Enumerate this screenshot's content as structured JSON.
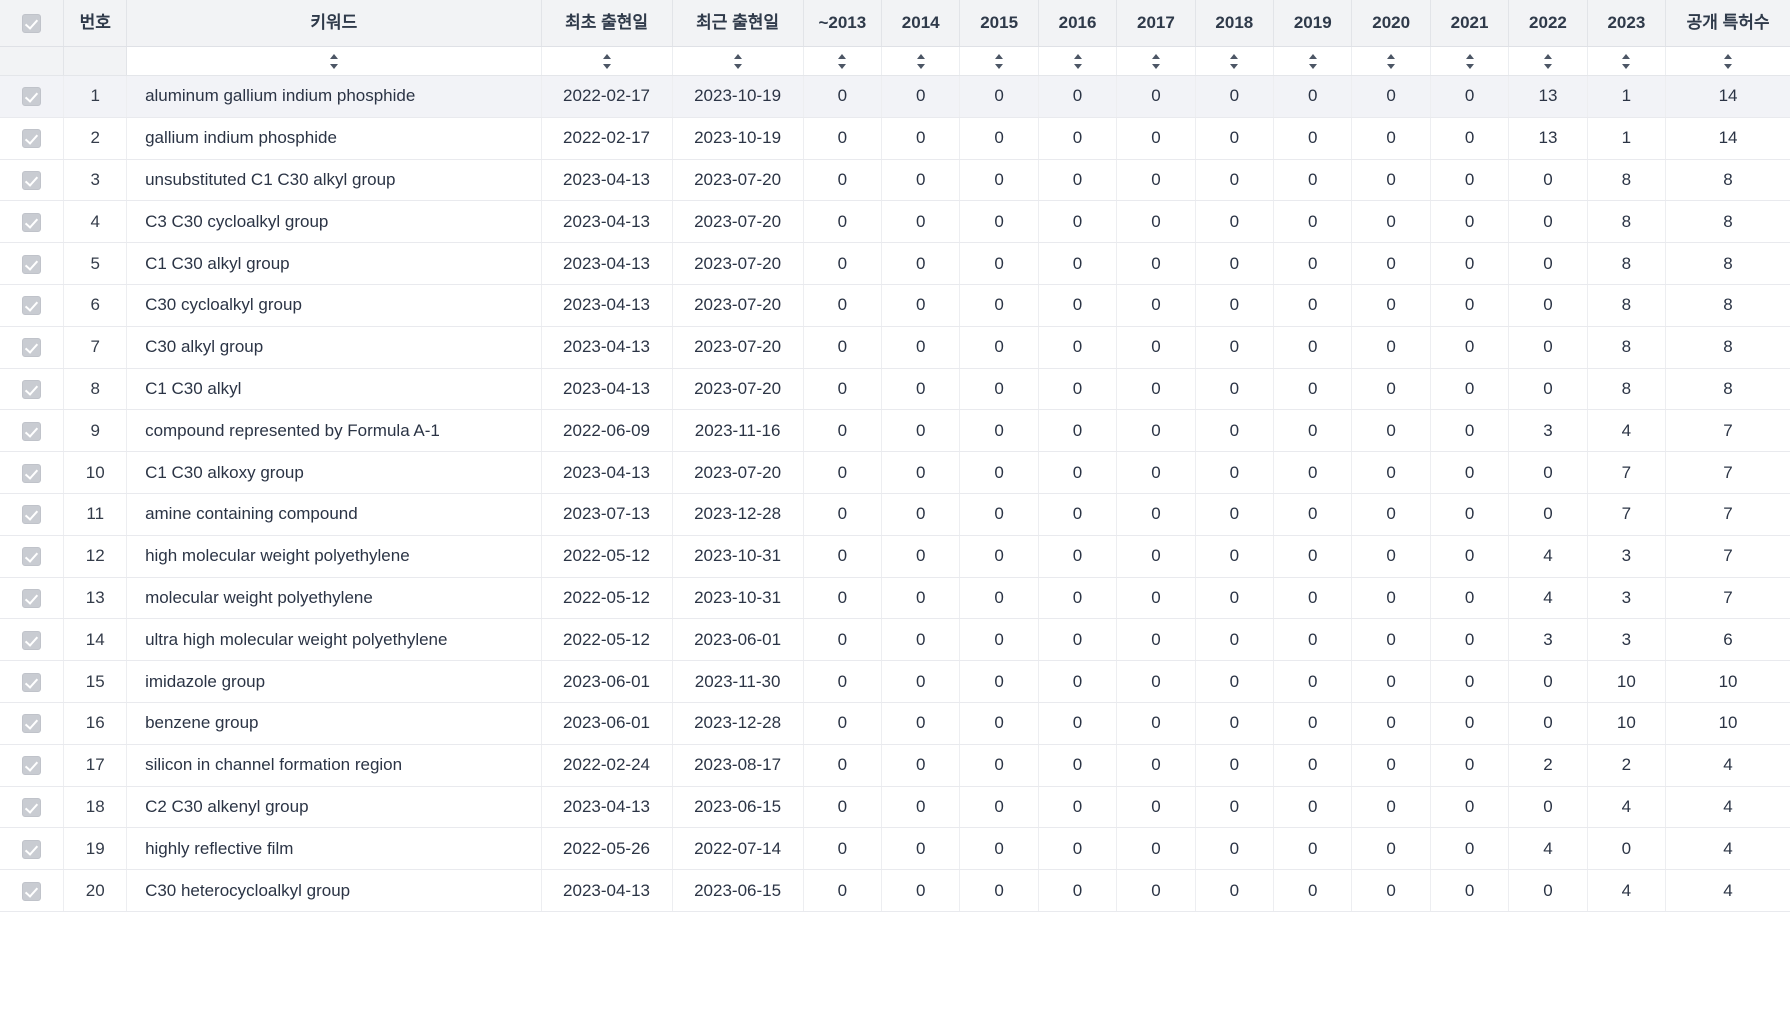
{
  "table": {
    "headers": {
      "check": "",
      "no": "번호",
      "keyword": "키워드",
      "first_date": "최초 출현일",
      "last_date": "최근 출현일",
      "years": [
        "~2013",
        "2014",
        "2015",
        "2016",
        "2017",
        "2018",
        "2019",
        "2020",
        "2021",
        "2022",
        "2023"
      ],
      "total": "공개 특허수"
    },
    "sort_icon_name": "sort-updown-icon",
    "checkbox_icon_name": "checkbox-checked-disabled-icon",
    "selected_row_index": 0,
    "rows": [
      {
        "no": "1",
        "keyword": "aluminum gallium indium phosphide",
        "first_date": "2022-02-17",
        "last_date": "2023-10-19",
        "years": [
          "0",
          "0",
          "0",
          "0",
          "0",
          "0",
          "0",
          "0",
          "0",
          "13",
          "1"
        ],
        "total": "14"
      },
      {
        "no": "2",
        "keyword": "gallium indium phosphide",
        "first_date": "2022-02-17",
        "last_date": "2023-10-19",
        "years": [
          "0",
          "0",
          "0",
          "0",
          "0",
          "0",
          "0",
          "0",
          "0",
          "13",
          "1"
        ],
        "total": "14"
      },
      {
        "no": "3",
        "keyword": "unsubstituted C1 C30 alkyl group",
        "first_date": "2023-04-13",
        "last_date": "2023-07-20",
        "years": [
          "0",
          "0",
          "0",
          "0",
          "0",
          "0",
          "0",
          "0",
          "0",
          "0",
          "8"
        ],
        "total": "8"
      },
      {
        "no": "4",
        "keyword": "C3 C30 cycloalkyl group",
        "first_date": "2023-04-13",
        "last_date": "2023-07-20",
        "years": [
          "0",
          "0",
          "0",
          "0",
          "0",
          "0",
          "0",
          "0",
          "0",
          "0",
          "8"
        ],
        "total": "8"
      },
      {
        "no": "5",
        "keyword": "C1 C30 alkyl group",
        "first_date": "2023-04-13",
        "last_date": "2023-07-20",
        "years": [
          "0",
          "0",
          "0",
          "0",
          "0",
          "0",
          "0",
          "0",
          "0",
          "0",
          "8"
        ],
        "total": "8"
      },
      {
        "no": "6",
        "keyword": "C30 cycloalkyl group",
        "first_date": "2023-04-13",
        "last_date": "2023-07-20",
        "years": [
          "0",
          "0",
          "0",
          "0",
          "0",
          "0",
          "0",
          "0",
          "0",
          "0",
          "8"
        ],
        "total": "8"
      },
      {
        "no": "7",
        "keyword": "C30 alkyl group",
        "first_date": "2023-04-13",
        "last_date": "2023-07-20",
        "years": [
          "0",
          "0",
          "0",
          "0",
          "0",
          "0",
          "0",
          "0",
          "0",
          "0",
          "8"
        ],
        "total": "8"
      },
      {
        "no": "8",
        "keyword": "C1 C30 alkyl",
        "first_date": "2023-04-13",
        "last_date": "2023-07-20",
        "years": [
          "0",
          "0",
          "0",
          "0",
          "0",
          "0",
          "0",
          "0",
          "0",
          "0",
          "8"
        ],
        "total": "8"
      },
      {
        "no": "9",
        "keyword": "compound represented by Formula A-1",
        "first_date": "2022-06-09",
        "last_date": "2023-11-16",
        "years": [
          "0",
          "0",
          "0",
          "0",
          "0",
          "0",
          "0",
          "0",
          "0",
          "3",
          "4"
        ],
        "total": "7"
      },
      {
        "no": "10",
        "keyword": "C1 C30 alkoxy group",
        "first_date": "2023-04-13",
        "last_date": "2023-07-20",
        "years": [
          "0",
          "0",
          "0",
          "0",
          "0",
          "0",
          "0",
          "0",
          "0",
          "0",
          "7"
        ],
        "total": "7"
      },
      {
        "no": "11",
        "keyword": "amine containing compound",
        "first_date": "2023-07-13",
        "last_date": "2023-12-28",
        "years": [
          "0",
          "0",
          "0",
          "0",
          "0",
          "0",
          "0",
          "0",
          "0",
          "0",
          "7"
        ],
        "total": "7"
      },
      {
        "no": "12",
        "keyword": "high molecular weight polyethylene",
        "first_date": "2022-05-12",
        "last_date": "2023-10-31",
        "years": [
          "0",
          "0",
          "0",
          "0",
          "0",
          "0",
          "0",
          "0",
          "0",
          "4",
          "3"
        ],
        "total": "7"
      },
      {
        "no": "13",
        "keyword": "molecular weight polyethylene",
        "first_date": "2022-05-12",
        "last_date": "2023-10-31",
        "years": [
          "0",
          "0",
          "0",
          "0",
          "0",
          "0",
          "0",
          "0",
          "0",
          "4",
          "3"
        ],
        "total": "7"
      },
      {
        "no": "14",
        "keyword": "ultra high molecular weight polyethylene",
        "first_date": "2022-05-12",
        "last_date": "2023-06-01",
        "years": [
          "0",
          "0",
          "0",
          "0",
          "0",
          "0",
          "0",
          "0",
          "0",
          "3",
          "3"
        ],
        "total": "6"
      },
      {
        "no": "15",
        "keyword": "imidazole group",
        "first_date": "2023-06-01",
        "last_date": "2023-11-30",
        "years": [
          "0",
          "0",
          "0",
          "0",
          "0",
          "0",
          "0",
          "0",
          "0",
          "0",
          "10"
        ],
        "total": "10"
      },
      {
        "no": "16",
        "keyword": "benzene group",
        "first_date": "2023-06-01",
        "last_date": "2023-12-28",
        "years": [
          "0",
          "0",
          "0",
          "0",
          "0",
          "0",
          "0",
          "0",
          "0",
          "0",
          "10"
        ],
        "total": "10"
      },
      {
        "no": "17",
        "keyword": "silicon in channel formation region",
        "first_date": "2022-02-24",
        "last_date": "2023-08-17",
        "years": [
          "0",
          "0",
          "0",
          "0",
          "0",
          "0",
          "0",
          "0",
          "0",
          "2",
          "2"
        ],
        "total": "4"
      },
      {
        "no": "18",
        "keyword": "C2 C30 alkenyl group",
        "first_date": "2023-04-13",
        "last_date": "2023-06-15",
        "years": [
          "0",
          "0",
          "0",
          "0",
          "0",
          "0",
          "0",
          "0",
          "0",
          "0",
          "4"
        ],
        "total": "4"
      },
      {
        "no": "19",
        "keyword": "highly reflective film",
        "first_date": "2022-05-26",
        "last_date": "2022-07-14",
        "years": [
          "0",
          "0",
          "0",
          "0",
          "0",
          "0",
          "0",
          "0",
          "0",
          "4",
          "0"
        ],
        "total": "4"
      },
      {
        "no": "20",
        "keyword": "C30 heterocycloalkyl group",
        "first_date": "2023-04-13",
        "last_date": "2023-06-15",
        "years": [
          "0",
          "0",
          "0",
          "0",
          "0",
          "0",
          "0",
          "0",
          "0",
          "0",
          "4"
        ],
        "total": "4"
      }
    ]
  },
  "colors": {
    "header_bg": "#f2f3f5",
    "selected_row_bg": "#f2f3f7",
    "text": "#2b3445",
    "border": "#e9eaee"
  }
}
